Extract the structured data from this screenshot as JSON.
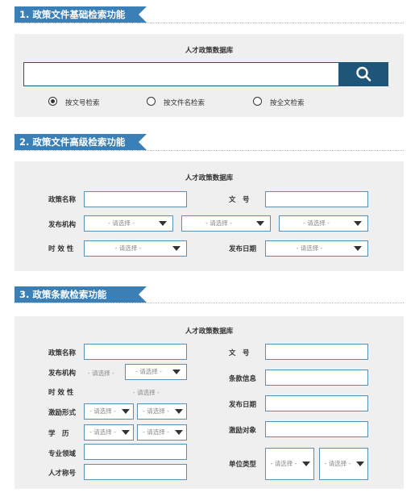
{
  "sections": [
    {
      "title": "1. 政策文件基础检索功能"
    },
    {
      "title": "2. 政策文件高级检索功能"
    },
    {
      "title": "3. 政策条款检索功能"
    }
  ],
  "basic": {
    "db_title": "人才政策数据库",
    "search_icon": "search-icon",
    "radios": [
      {
        "label": "按文号检索",
        "selected": true
      },
      {
        "label": "按文件名检索",
        "selected": false
      },
      {
        "label": "按全文检索",
        "selected": false
      }
    ]
  },
  "advanced": {
    "db_title": "人才政策数据库",
    "policy_name_label": "政策名称",
    "doc_no_label": "文　号",
    "issuer_label": "发布机构",
    "validity_label": "时 效 性",
    "date_label": "发布日期",
    "select_placeholder": "- 请选择 -"
  },
  "clause": {
    "db_title": "人才政策数据库",
    "policy_name_label": "政策名称",
    "doc_no_label": "文　号",
    "issuer_label": "发布机构",
    "clause_info_label": "条款信息",
    "validity_label": "时 效 性",
    "date_label": "发布日期",
    "incentive_form_label": "激励形式",
    "education_label": "学　历",
    "incentive_target_label": "激励对象",
    "field_label": "专业领域",
    "title_label": "人才称号",
    "unit_type_label": "单位类型",
    "select_placeholder": "- 请选择 -"
  },
  "colors": {
    "accent": "#3b7fb7",
    "search_button": "#1e5578",
    "panel": "#efefef",
    "border": "#5a8fb5"
  }
}
